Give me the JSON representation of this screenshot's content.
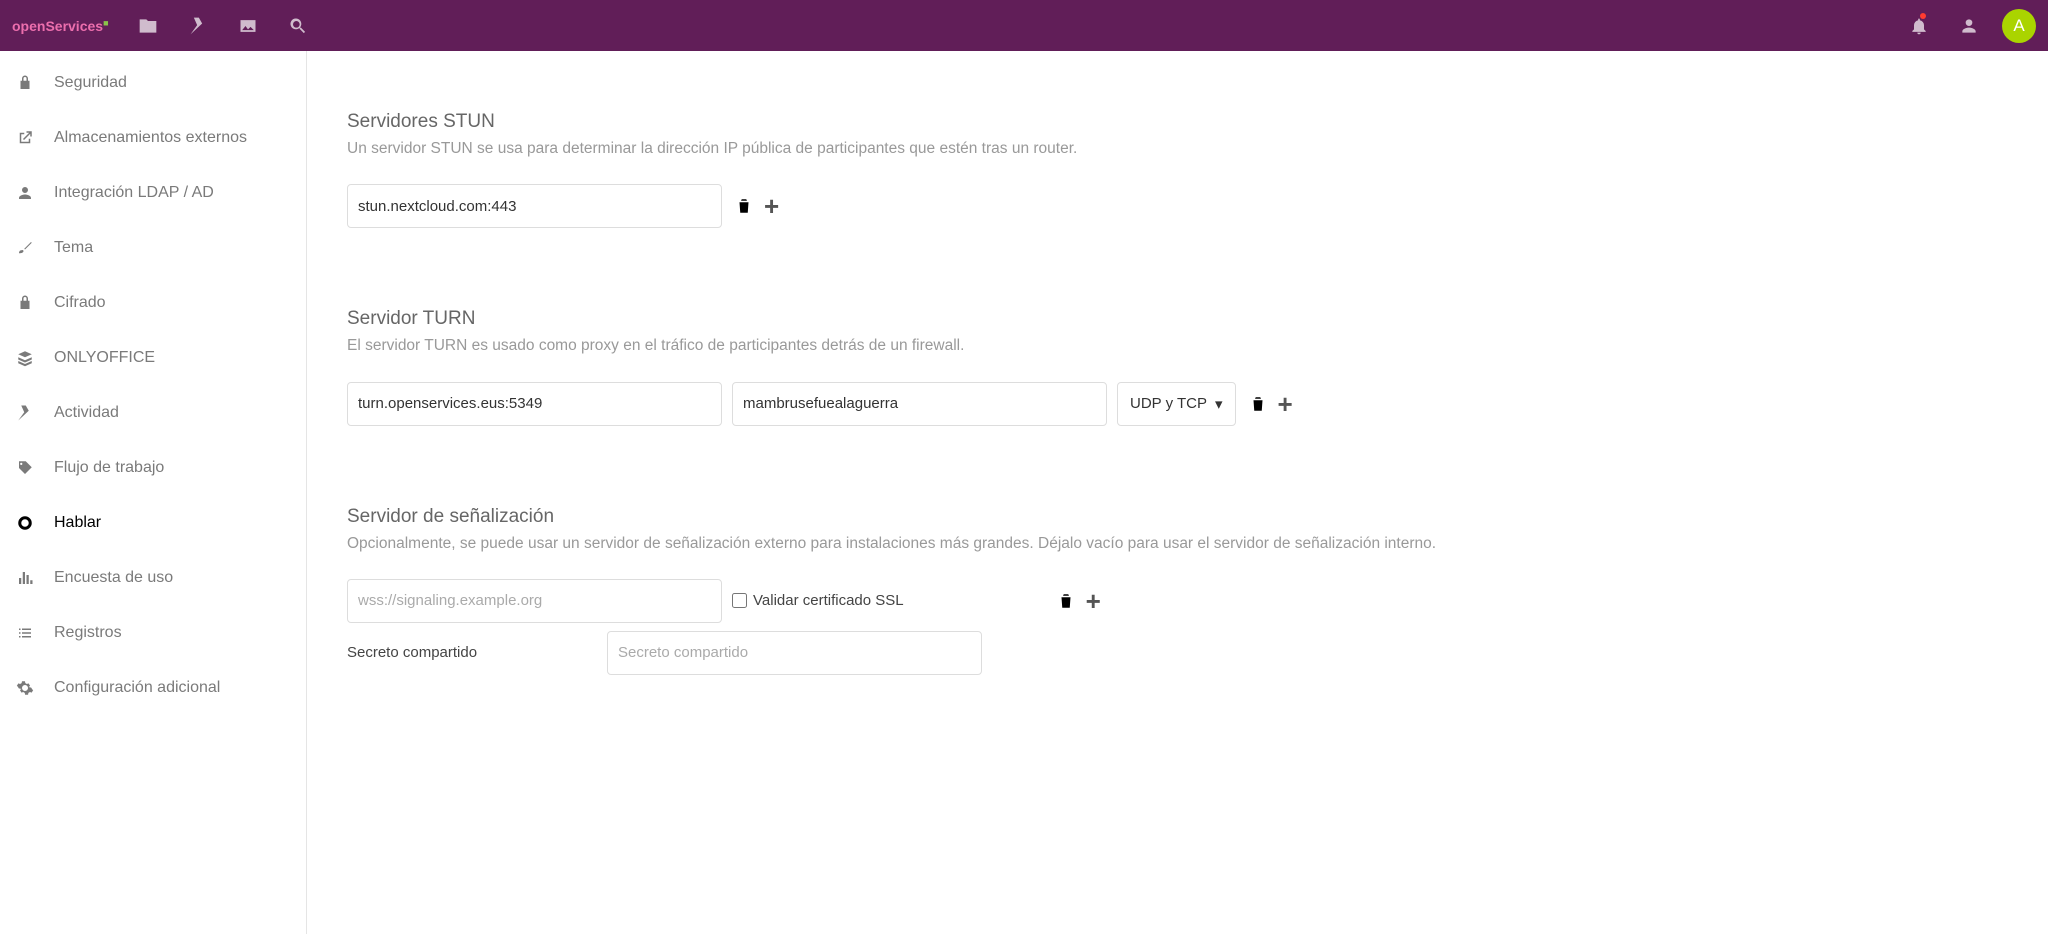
{
  "brand": "openServices",
  "avatarLetter": "A",
  "sidebar": {
    "items": [
      {
        "label": "Seguridad"
      },
      {
        "label": "Almacenamientos externos"
      },
      {
        "label": "Integración LDAP / AD"
      },
      {
        "label": "Tema"
      },
      {
        "label": "Cifrado"
      },
      {
        "label": "ONLYOFFICE"
      },
      {
        "label": "Actividad"
      },
      {
        "label": "Flujo de trabajo"
      },
      {
        "label": "Hablar"
      },
      {
        "label": "Encuesta de uso"
      },
      {
        "label": "Registros"
      },
      {
        "label": "Configuración adicional"
      }
    ]
  },
  "stun": {
    "title": "Servidores STUN",
    "desc": "Un servidor STUN se usa para determinar la dirección IP pública de participantes que estén tras un router.",
    "value": "stun.nextcloud.com:443"
  },
  "turn": {
    "title": "Servidor TURN",
    "desc": "El servidor TURN es usado como proxy en el tráfico de participantes detrás de un firewall.",
    "server": "turn.openservices.eus:5349",
    "secret": "mambrusefuealaguerra",
    "protoLabel": "UDP y TCP"
  },
  "signaling": {
    "title": "Servidor de señalización",
    "desc": "Opcionalmente, se puede usar un servidor de señalización externo para instalaciones más grandes. Déjalo vacío para usar el servidor de señalización interno.",
    "placeholder": "wss://signaling.example.org",
    "sslLabel": "Validar certificado SSL",
    "sharedLabel": "Secreto compartido",
    "sharedPlaceholder": "Secreto compartido"
  }
}
